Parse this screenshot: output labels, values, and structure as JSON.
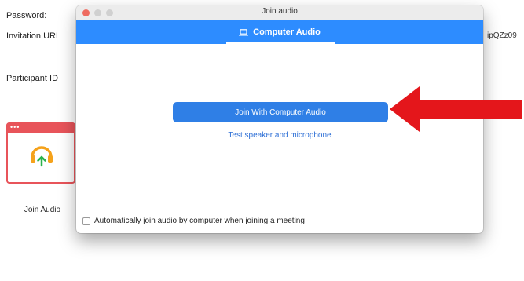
{
  "background": {
    "password_label": "Password:",
    "invitation_label": "Invitation URL",
    "invitation_tail": "ipQZz09",
    "participant_label": "Participant ID",
    "join_audio_caption": "Join Audio",
    "tile_dots": "•••"
  },
  "dialog": {
    "window_title": "Join audio",
    "tab_label": "Computer Audio",
    "join_button_label": "Join With Computer Audio",
    "test_link_label": "Test speaker and microphone",
    "auto_join_label": "Automatically join audio by computer when joining a meeting",
    "auto_join_checked": false
  },
  "icons": {
    "tab_icon": "laptop-icon",
    "tile_icon": "headphones-icon",
    "pointer": "red-arrow-annotation"
  },
  "colors": {
    "accent_blue": "#2d8cff",
    "button_blue": "#2f7fe6",
    "tile_red": "#e8545a",
    "arrow_red": "#e4161b"
  }
}
